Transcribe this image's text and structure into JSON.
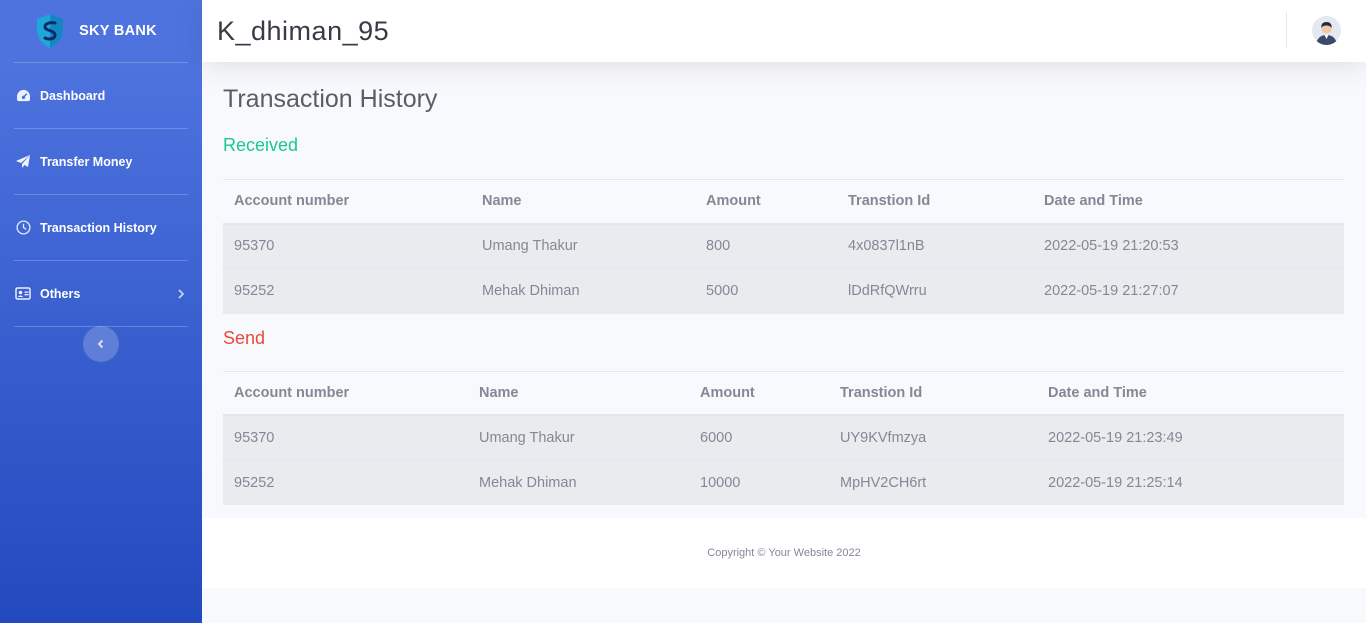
{
  "brand": {
    "name": "SKY BANK",
    "logo_icon": "shield-logo-icon"
  },
  "sidebar": {
    "items": [
      {
        "label": "Dashboard",
        "icon": "tachometer-icon"
      },
      {
        "label": "Transfer Money",
        "icon": "paper-plane-icon"
      },
      {
        "label": "Transaction History",
        "icon": "clock-icon"
      },
      {
        "label": "Others",
        "icon": "id-card-icon",
        "has_submenu": true
      }
    ],
    "toggle_icon": "chevron-left-icon"
  },
  "topbar": {
    "username": "K_dhiman_95",
    "avatar_icon": "user-avatar-icon"
  },
  "page": {
    "title": "Transaction History",
    "received": {
      "label": "Received",
      "label_color": "#1cc88a",
      "columns": [
        "Account number",
        "Name",
        "Amount",
        "Transtion Id",
        "Date and Time"
      ],
      "rows": [
        [
          "95370",
          "Umang Thakur",
          "800",
          "4x0837l1nB",
          "2022-05-19 21:20:53"
        ],
        [
          "95252",
          "Mehak Dhiman",
          "5000",
          "lDdRfQWrru",
          "2022-05-19 21:27:07"
        ]
      ]
    },
    "send": {
      "label": "Send",
      "label_color": "#e74a3b",
      "columns": [
        "Account number",
        "Name",
        "Amount",
        "Transtion Id",
        "Date and Time"
      ],
      "rows": [
        [
          "95370",
          "Umang Thakur",
          "6000",
          "UY9KVfmzya",
          "2022-05-19 21:23:49"
        ],
        [
          "95252",
          "Mehak Dhiman",
          "10000",
          "MpHV2CH6rt",
          "2022-05-19 21:25:14"
        ]
      ]
    }
  },
  "footer": {
    "copyright": "Copyright © Your Website 2022"
  },
  "colors": {
    "sidebar_top": "#4e73df",
    "sidebar_bottom": "#224abe",
    "text": "#858796"
  }
}
